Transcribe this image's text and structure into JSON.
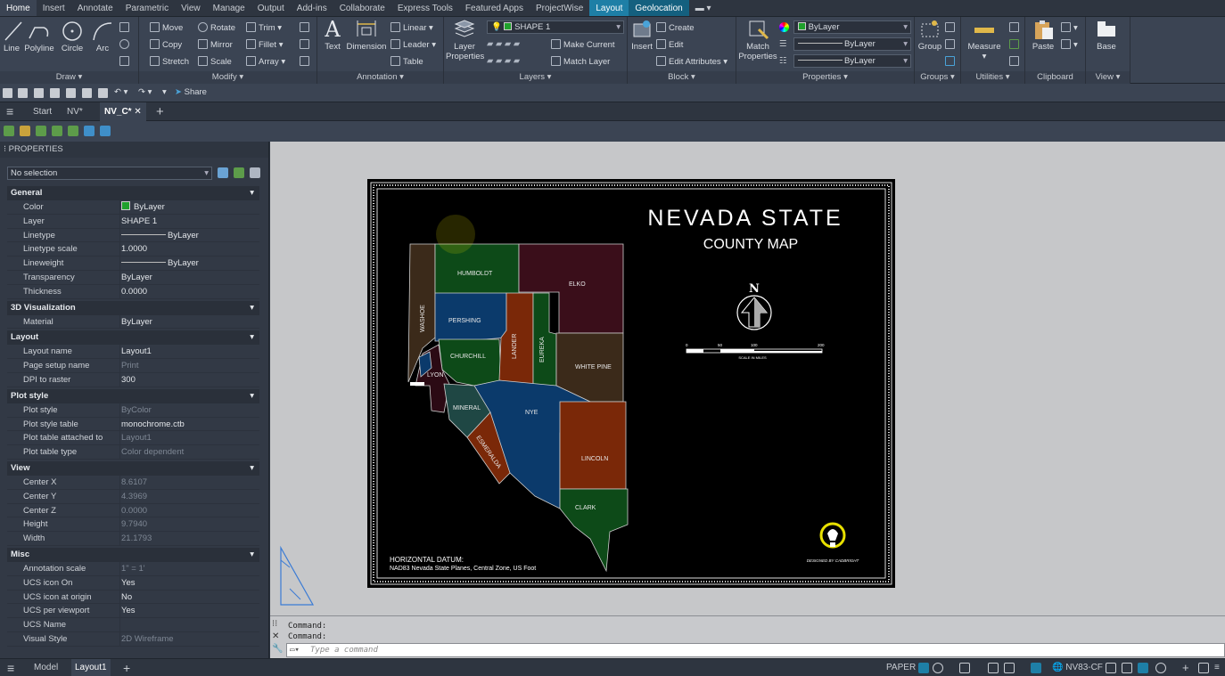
{
  "ribbon_tabs": [
    "Home",
    "Insert",
    "Annotate",
    "Parametric",
    "View",
    "Manage",
    "Output",
    "Add-ins",
    "Collaborate",
    "Express Tools",
    "Featured Apps",
    "ProjectWise",
    "Layout",
    "Geolocation"
  ],
  "draw": {
    "title": "Draw",
    "line": "Line",
    "polyline": "Polyline",
    "circle": "Circle",
    "arc": "Arc"
  },
  "modify": {
    "title": "Modify",
    "move": "Move",
    "rotate": "Rotate",
    "trim": "Trim",
    "copy": "Copy",
    "mirror": "Mirror",
    "fillet": "Fillet",
    "stretch": "Stretch",
    "scale": "Scale",
    "array": "Array"
  },
  "annotation": {
    "title": "Annotation",
    "text": "Text",
    "dimension": "Dimension",
    "linear": "Linear",
    "leader": "Leader",
    "table": "Table"
  },
  "layers": {
    "title": "Layers",
    "layer_properties_1": "Layer",
    "layer_properties_2": "Properties",
    "current_layer": "SHAPE 1",
    "make_current": "Make Current",
    "match_layer": "Match Layer"
  },
  "block": {
    "title": "Block",
    "insert": "Insert",
    "create": "Create",
    "edit": "Edit",
    "edit_attributes": "Edit Attributes"
  },
  "properties_panel": {
    "title": "Properties",
    "match_1": "Match",
    "match_2": "Properties",
    "color": "ByLayer",
    "lineweight": "ByLayer",
    "linetype": "ByLayer"
  },
  "groups": {
    "title": "Groups",
    "group": "Group"
  },
  "utilities": {
    "title": "Utilities",
    "measure": "Measure"
  },
  "clipboard": {
    "title": "Clipboard",
    "paste": "Paste"
  },
  "view_panel": {
    "title": "View",
    "base": "Base"
  },
  "qat": {
    "share": "Share"
  },
  "doc_tabs": {
    "start": "Start",
    "nv": "NV*",
    "nvc": "NV_C*"
  },
  "properties": {
    "header": "PROPERTIES",
    "selection": "No selection",
    "sections": [
      {
        "name": "General",
        "rows": [
          [
            "Color",
            "ByLayer"
          ],
          [
            "Layer",
            "SHAPE 1"
          ],
          [
            "Linetype",
            "ByLayer"
          ],
          [
            "Linetype scale",
            "1.0000"
          ],
          [
            "Lineweight",
            "ByLayer"
          ],
          [
            "Transparency",
            "ByLayer"
          ],
          [
            "Thickness",
            "0.0000"
          ]
        ]
      },
      {
        "name": "3D Visualization",
        "rows": [
          [
            "Material",
            "ByLayer"
          ]
        ]
      },
      {
        "name": "Layout",
        "rows": [
          [
            "Layout name",
            "Layout1"
          ],
          [
            "Page setup name",
            "Print"
          ],
          [
            "DPI to raster",
            "300"
          ]
        ]
      },
      {
        "name": "Plot style",
        "rows": [
          [
            "Plot style",
            "ByColor"
          ],
          [
            "Plot style table",
            "monochrome.ctb"
          ],
          [
            "Plot table attached to",
            "Layout1"
          ],
          [
            "Plot table type",
            "Color dependent"
          ]
        ]
      },
      {
        "name": "View",
        "rows": [
          [
            "Center X",
            "8.6107"
          ],
          [
            "Center Y",
            "4.3969"
          ],
          [
            "Center Z",
            "0.0000"
          ],
          [
            "Height",
            "9.7940"
          ],
          [
            "Width",
            "21.1793"
          ]
        ]
      },
      {
        "name": "Misc",
        "rows": [
          [
            "Annotation scale",
            "1\" = 1'"
          ],
          [
            "UCS icon On",
            "Yes"
          ],
          [
            "UCS icon at origin",
            "No"
          ],
          [
            "UCS per viewport",
            "Yes"
          ],
          [
            "UCS Name",
            ""
          ],
          [
            "Visual Style",
            "2D Wireframe"
          ]
        ]
      }
    ]
  },
  "map": {
    "title": "NEVADA STATE",
    "subtitle": "COUNTY MAP",
    "north": "N",
    "scale_ticks": [
      "0",
      "50",
      "100",
      "200"
    ],
    "scale_label": "SCALE IN MILES",
    "datum_1": "HORIZONTAL DATUM:",
    "datum_2": "NAD83 Nevada State Planes, Central Zone, US Foot",
    "designer": "DESIGNED BY CADBRIGHT",
    "counties": {
      "humboldt": "HUMBOLDT",
      "elko": "ELKO",
      "washoe": "WASHOE",
      "pershing": "PERSHING",
      "churchill": "CHURCHILL",
      "lander": "LANDER",
      "eureka": "EUREKA",
      "white_pine": "WHITE PINE",
      "lyon": "LYON",
      "mineral": "MINERAL",
      "nye": "NYE",
      "esmeralda": "ESMERALDA",
      "lincoln": "LINCOLN",
      "clark": "CLARK"
    }
  },
  "command": {
    "line1": "Command:",
    "line2": "Command:",
    "placeholder": "Type a command"
  },
  "status": {
    "model": "Model",
    "layout": "Layout1",
    "paper": "PAPER",
    "coord": "NV83-CF"
  }
}
